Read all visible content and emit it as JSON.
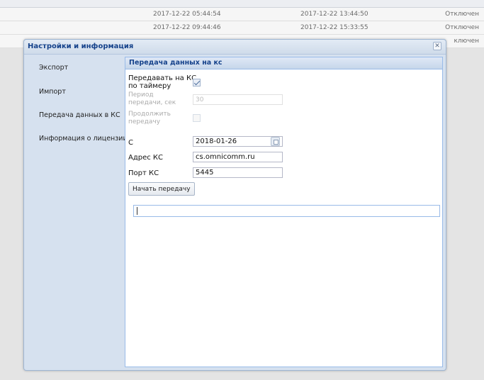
{
  "background_table": {
    "rows": [
      {
        "start": "2017-12-22 05:44:54",
        "end": "2017-12-22 13:44:50",
        "status": "Отключен"
      },
      {
        "start": "2017-12-22 09:44:46",
        "end": "2017-12-22 15:33:55",
        "status": "Отключен"
      },
      {
        "status_partial": "ключен"
      }
    ]
  },
  "window": {
    "title": "Настройки и информация",
    "close_glyph": "✕"
  },
  "nav": {
    "items": [
      {
        "label": "Экспорт"
      },
      {
        "label": "Импорт"
      },
      {
        "label": "Передача данных в КС"
      },
      {
        "label": "Информация о лицензии"
      }
    ]
  },
  "panel": {
    "title": "Передача данных на кс",
    "timer": {
      "label_line1": "Передавать на КС",
      "label_line2": "по таймеру",
      "checked": true
    },
    "period": {
      "label_line1": "Период",
      "label_line2": "передачи, сек",
      "value": "30"
    },
    "continue": {
      "label_line1": "Продолжить",
      "label_line2": "передачу",
      "checked": false
    },
    "from": {
      "label": "С",
      "value": "2018-01-26"
    },
    "address": {
      "label": "Адрес КС",
      "value": "cs.omnicomm.ru"
    },
    "port": {
      "label": "Порт КС",
      "value": "5445"
    },
    "start_button": "Начать передачу",
    "log_value": ""
  },
  "icons": {
    "calendar": "calendar-icon",
    "close": "close-icon",
    "check": "checkmark-icon"
  },
  "colors": {
    "accent": "#15428b",
    "window_bg": "#d6e1ef",
    "panel_border": "#99bbe8"
  }
}
